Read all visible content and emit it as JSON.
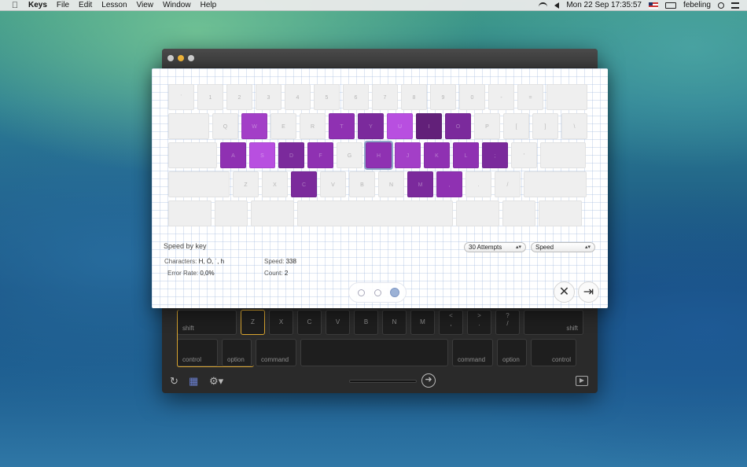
{
  "menubar": {
    "app": "Keys",
    "menus": [
      "File",
      "Edit",
      "Lesson",
      "View",
      "Window",
      "Help"
    ],
    "clock": "Mon 22 Sep  17:35:57",
    "user": "febeling"
  },
  "colors": {
    "heat_levels": [
      "#efefef",
      "#b84fe0",
      "#a33fc7",
      "#8f31b2",
      "#7b2a9c",
      "#622079"
    ]
  },
  "panel": {
    "title": "Speed by key",
    "attempts_select": "30 Attempts",
    "metric_select": "Speed",
    "stats": {
      "characters_label": "Characters:",
      "characters_value": "H, Ó, ˙, h",
      "speed_label": "Speed:",
      "speed_value": "338",
      "error_label": "Error Rate:",
      "error_value": "0,0%",
      "count_label": "Count:",
      "count_value": "2"
    },
    "pages": 3,
    "current_page": 3,
    "rows": [
      [
        {
          "l": "`",
          "h": 0
        },
        {
          "l": "1",
          "h": 0
        },
        {
          "l": "2",
          "h": 0
        },
        {
          "l": "3",
          "h": 0
        },
        {
          "l": "4",
          "h": 0
        },
        {
          "l": "5",
          "h": 0
        },
        {
          "l": "6",
          "h": 0
        },
        {
          "l": "7",
          "h": 0
        },
        {
          "l": "8",
          "h": 0
        },
        {
          "l": "9",
          "h": 0
        },
        {
          "l": "0",
          "h": 0
        },
        {
          "l": "-",
          "h": 0
        },
        {
          "l": "=",
          "h": 0
        },
        {
          "l": "",
          "h": 0
        }
      ],
      [
        {
          "l": "",
          "h": 0
        },
        {
          "l": "Q",
          "h": 0
        },
        {
          "l": "W",
          "h": 2
        },
        {
          "l": "E",
          "h": 0
        },
        {
          "l": "R",
          "h": 0
        },
        {
          "l": "T",
          "h": 3
        },
        {
          "l": "Y",
          "h": 4
        },
        {
          "l": "U",
          "h": 1
        },
        {
          "l": "I",
          "h": 5
        },
        {
          "l": "O",
          "h": 4
        },
        {
          "l": "P",
          "h": 0
        },
        {
          "l": "[",
          "h": 0
        },
        {
          "l": "]",
          "h": 0
        },
        {
          "l": "\\",
          "h": 0
        }
      ],
      [
        {
          "l": "",
          "h": 0
        },
        {
          "l": "A",
          "h": 3
        },
        {
          "l": "S",
          "h": 1
        },
        {
          "l": "D",
          "h": 4
        },
        {
          "l": "F",
          "h": 3
        },
        {
          "l": "G",
          "h": 0
        },
        {
          "l": "H",
          "h": 3,
          "sel": true
        },
        {
          "l": "J",
          "h": 2
        },
        {
          "l": "K",
          "h": 3
        },
        {
          "l": "L",
          "h": 3
        },
        {
          "l": ";",
          "h": 4
        },
        {
          "l": "'",
          "h": 0
        },
        {
          "l": "",
          "h": 0
        }
      ],
      [
        {
          "l": "",
          "h": 0
        },
        {
          "l": "Z",
          "h": 0
        },
        {
          "l": "X",
          "h": 0
        },
        {
          "l": "C",
          "h": 4
        },
        {
          "l": "V",
          "h": 0
        },
        {
          "l": "B",
          "h": 0
        },
        {
          "l": "N",
          "h": 0
        },
        {
          "l": "M",
          "h": 4
        },
        {
          "l": ",",
          "h": 3
        },
        {
          "l": ".",
          "h": 0
        },
        {
          "l": "/",
          "h": 0
        },
        {
          "l": "",
          "h": 0
        }
      ],
      [
        {
          "l": "",
          "h": 0
        },
        {
          "l": "",
          "h": 0
        },
        {
          "l": "",
          "h": 0
        },
        {
          "l": "",
          "h": 0
        },
        {
          "l": "",
          "h": 0
        },
        {
          "l": "",
          "h": 0
        },
        {
          "l": "",
          "h": 0
        }
      ]
    ]
  },
  "keyboard": {
    "row_shift": [
      {
        "t": "shift",
        "kind": "lab"
      },
      {
        "t": "Z",
        "kind": "ctr"
      },
      {
        "t": "X",
        "kind": "ctr"
      },
      {
        "t": "C",
        "kind": "ctr"
      },
      {
        "t": "V",
        "kind": "ctr"
      },
      {
        "t": "B",
        "kind": "ctr"
      },
      {
        "t": "N",
        "kind": "ctr"
      },
      {
        "t": "M",
        "kind": "ctr"
      },
      {
        "t": "<",
        "b": ",",
        "kind": "two"
      },
      {
        "t": ">",
        "b": ".",
        "kind": "two"
      },
      {
        "t": "?",
        "b": "/",
        "kind": "two"
      },
      {
        "t": "shift",
        "kind": "labr"
      }
    ],
    "row_bottom": [
      {
        "t": "control",
        "kind": "lab"
      },
      {
        "t": "option",
        "kind": "lab"
      },
      {
        "t": "command",
        "kind": "lab"
      },
      {
        "t": "",
        "kind": "ctr"
      },
      {
        "t": "command",
        "kind": "lab"
      },
      {
        "t": "option",
        "kind": "lab"
      },
      {
        "t": "control",
        "kind": "labr"
      }
    ]
  }
}
